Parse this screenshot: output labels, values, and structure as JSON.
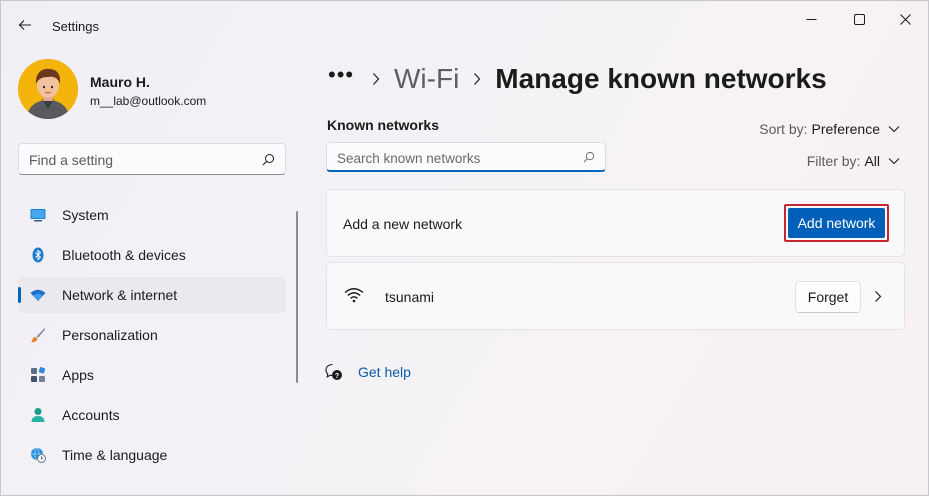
{
  "window": {
    "title": "Settings"
  },
  "profile": {
    "name": "Mauro H.",
    "email": "m__lab@outlook.com"
  },
  "sidebar": {
    "search_placeholder": "Find a setting",
    "items": [
      {
        "label": "System",
        "icon": "monitor-icon",
        "active": false
      },
      {
        "label": "Bluetooth & devices",
        "icon": "bluetooth-icon",
        "active": false
      },
      {
        "label": "Network & internet",
        "icon": "wifi-icon",
        "active": true
      },
      {
        "label": "Personalization",
        "icon": "brush-icon",
        "active": false
      },
      {
        "label": "Apps",
        "icon": "apps-icon",
        "active": false
      },
      {
        "label": "Accounts",
        "icon": "person-icon",
        "active": false
      },
      {
        "label": "Time & language",
        "icon": "globe-clock-icon",
        "active": false
      }
    ]
  },
  "breadcrumb": {
    "more": "•••",
    "parent": "Wi-Fi",
    "current": "Manage known networks"
  },
  "known": {
    "section_label": "Known networks",
    "search_placeholder": "Search known networks",
    "sort_label": "Sort by:",
    "sort_value": "Preference",
    "filter_label": "Filter by:",
    "filter_value": "All",
    "add_label": "Add a new network",
    "add_button": "Add network",
    "networks": [
      {
        "name": "tsunami",
        "forget_label": "Forget"
      }
    ]
  },
  "help": {
    "label": "Get help"
  },
  "colors": {
    "accent": "#005fb8",
    "highlight_border": "#c4272f",
    "link": "#0a5ca8"
  }
}
